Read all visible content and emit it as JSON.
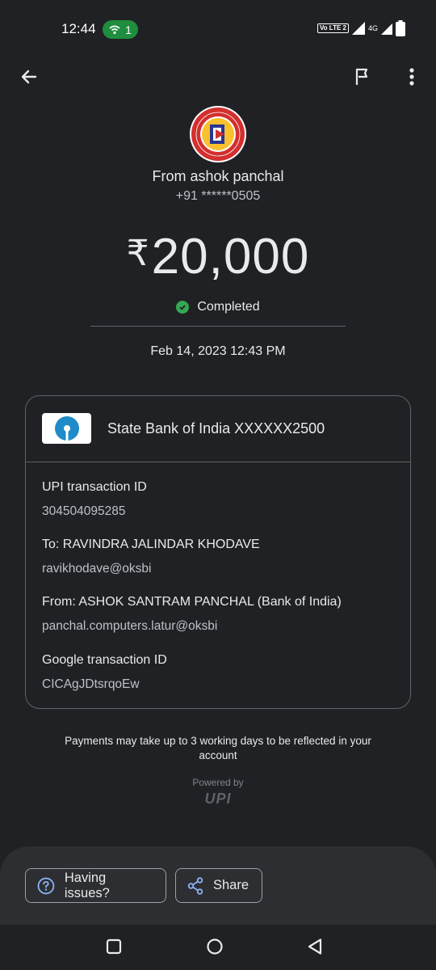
{
  "status_bar": {
    "time": "12:44",
    "hotspot_count": "1",
    "volte_label": "Vo LTE 2",
    "network_label": "4G"
  },
  "header": {
    "logo_text_top": "PANCHAL COMPUTER CLASSES",
    "logo_text_bottom": "LATUR"
  },
  "payer": {
    "from_label": "From ashok panchal",
    "phone": "+91 ******0505"
  },
  "payment": {
    "currency_symbol": "₹",
    "amount": "20,000",
    "status": "Completed",
    "datetime": "Feb 14, 2023 12:43 PM"
  },
  "details": {
    "bank_name": "State Bank of India XXXXXX2500",
    "upi_txn_label": "UPI transaction ID",
    "upi_txn_value": "304504095285",
    "to_label": "To: RAVINDRA JALINDAR KHODAVE",
    "to_value": "ravikhodave@oksbi",
    "from_label": "From: ASHOK SANTRAM PANCHAL (Bank of India)",
    "from_value": "panchal.computers.latur@oksbi",
    "google_txn_label": "Google transaction ID",
    "google_txn_value": "CICAgJDtsrqoEw"
  },
  "footer": {
    "note": "Payments may take up to 3 working days to be reflected in your account",
    "powered_by": "Powered by",
    "upi_logo": "UPI"
  },
  "actions": {
    "issues_label": "Having issues?",
    "share_label": "Share"
  },
  "colors": {
    "background": "#202124",
    "success": "#34a853",
    "hotspot": "#1e8e3e",
    "accent_blue": "#8ab4f8"
  }
}
